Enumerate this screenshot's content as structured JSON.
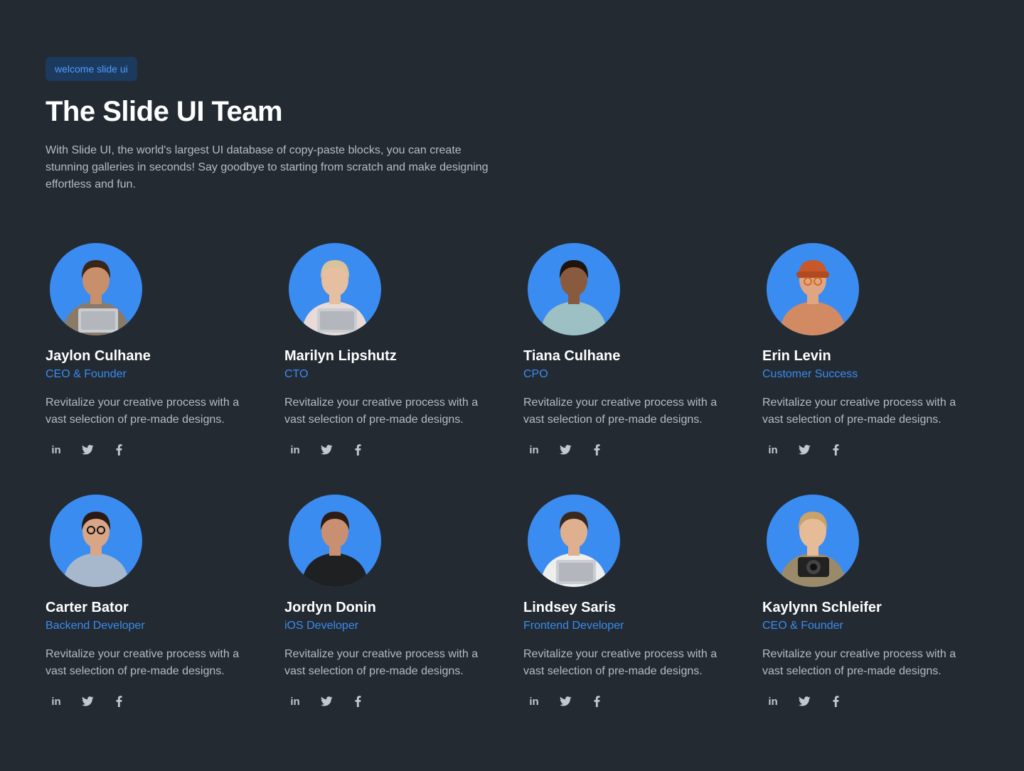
{
  "header": {
    "badge": "welcome slide ui",
    "title": "The Slide UI Team",
    "intro": "With Slide UI, the world's largest UI database of copy-paste blocks, you can create stunning galleries in seconds! Say goodbye to starting from scratch and make designing effortless and fun."
  },
  "colors": {
    "background": "#232a32",
    "accent": "#3b8cf0",
    "badge_bg": "#1c3a5e",
    "muted_text": "#b6bcc4"
  },
  "team": [
    {
      "name": "Jaylon Culhane",
      "role": "CEO & Founder",
      "bio": "Revitalize your creative process with a vast selection of pre-made designs.",
      "skin": "#c8906a",
      "hair": "#3a2618",
      "shirt": "#8a7b68",
      "prop": "laptop"
    },
    {
      "name": "Marilyn Lipshutz",
      "role": "CTO",
      "bio": "Revitalize your creative process with a vast selection of pre-made designs.",
      "skin": "#e6bfa0",
      "hair": "#d8c29a",
      "shirt": "#e8dad6",
      "prop": "laptop"
    },
    {
      "name": "Tiana Culhane",
      "role": "CPO",
      "bio": "Revitalize your creative process with a vast selection of pre-made designs.",
      "skin": "#8a5a3e",
      "hair": "#1e140e",
      "shirt": "#9cc0c4",
      "prop": "none"
    },
    {
      "name": "Erin Levin",
      "role": "Customer Success",
      "bio": "Revitalize your creative process with a vast selection of pre-made designs.",
      "skin": "#e0a684",
      "hair": "#c8582a",
      "shirt": "#d28a62",
      "prop": "beanie"
    },
    {
      "name": "Carter Bator",
      "role": "Backend Developer",
      "bio": "Revitalize your creative process with a vast selection of pre-made designs.",
      "skin": "#d8a686",
      "hair": "#2a1a12",
      "shirt": "#a8b8cc",
      "prop": "glasses"
    },
    {
      "name": "Jordyn Donin",
      "role": "iOS Developer",
      "bio": "Revitalize your creative process with a vast selection of pre-made designs.",
      "skin": "#c89070",
      "hair": "#2e1c14",
      "shirt": "#1e2022",
      "prop": "none"
    },
    {
      "name": "Lindsey Saris",
      "role": "Frontend Developer",
      "bio": "Revitalize your creative process with a vast selection of pre-made designs.",
      "skin": "#deb090",
      "hair": "#3a281c",
      "shirt": "#eeeeec",
      "prop": "laptop"
    },
    {
      "name": "Kaylynn Schleifer",
      "role": "CEO & Founder",
      "bio": "Revitalize your creative process with a vast selection of pre-made designs.",
      "skin": "#e6bc98",
      "hair": "#c8a268",
      "shirt": "#9a8a6a",
      "prop": "camera"
    }
  ],
  "social_icons": [
    "linkedin-icon",
    "twitter-icon",
    "facebook-icon"
  ]
}
